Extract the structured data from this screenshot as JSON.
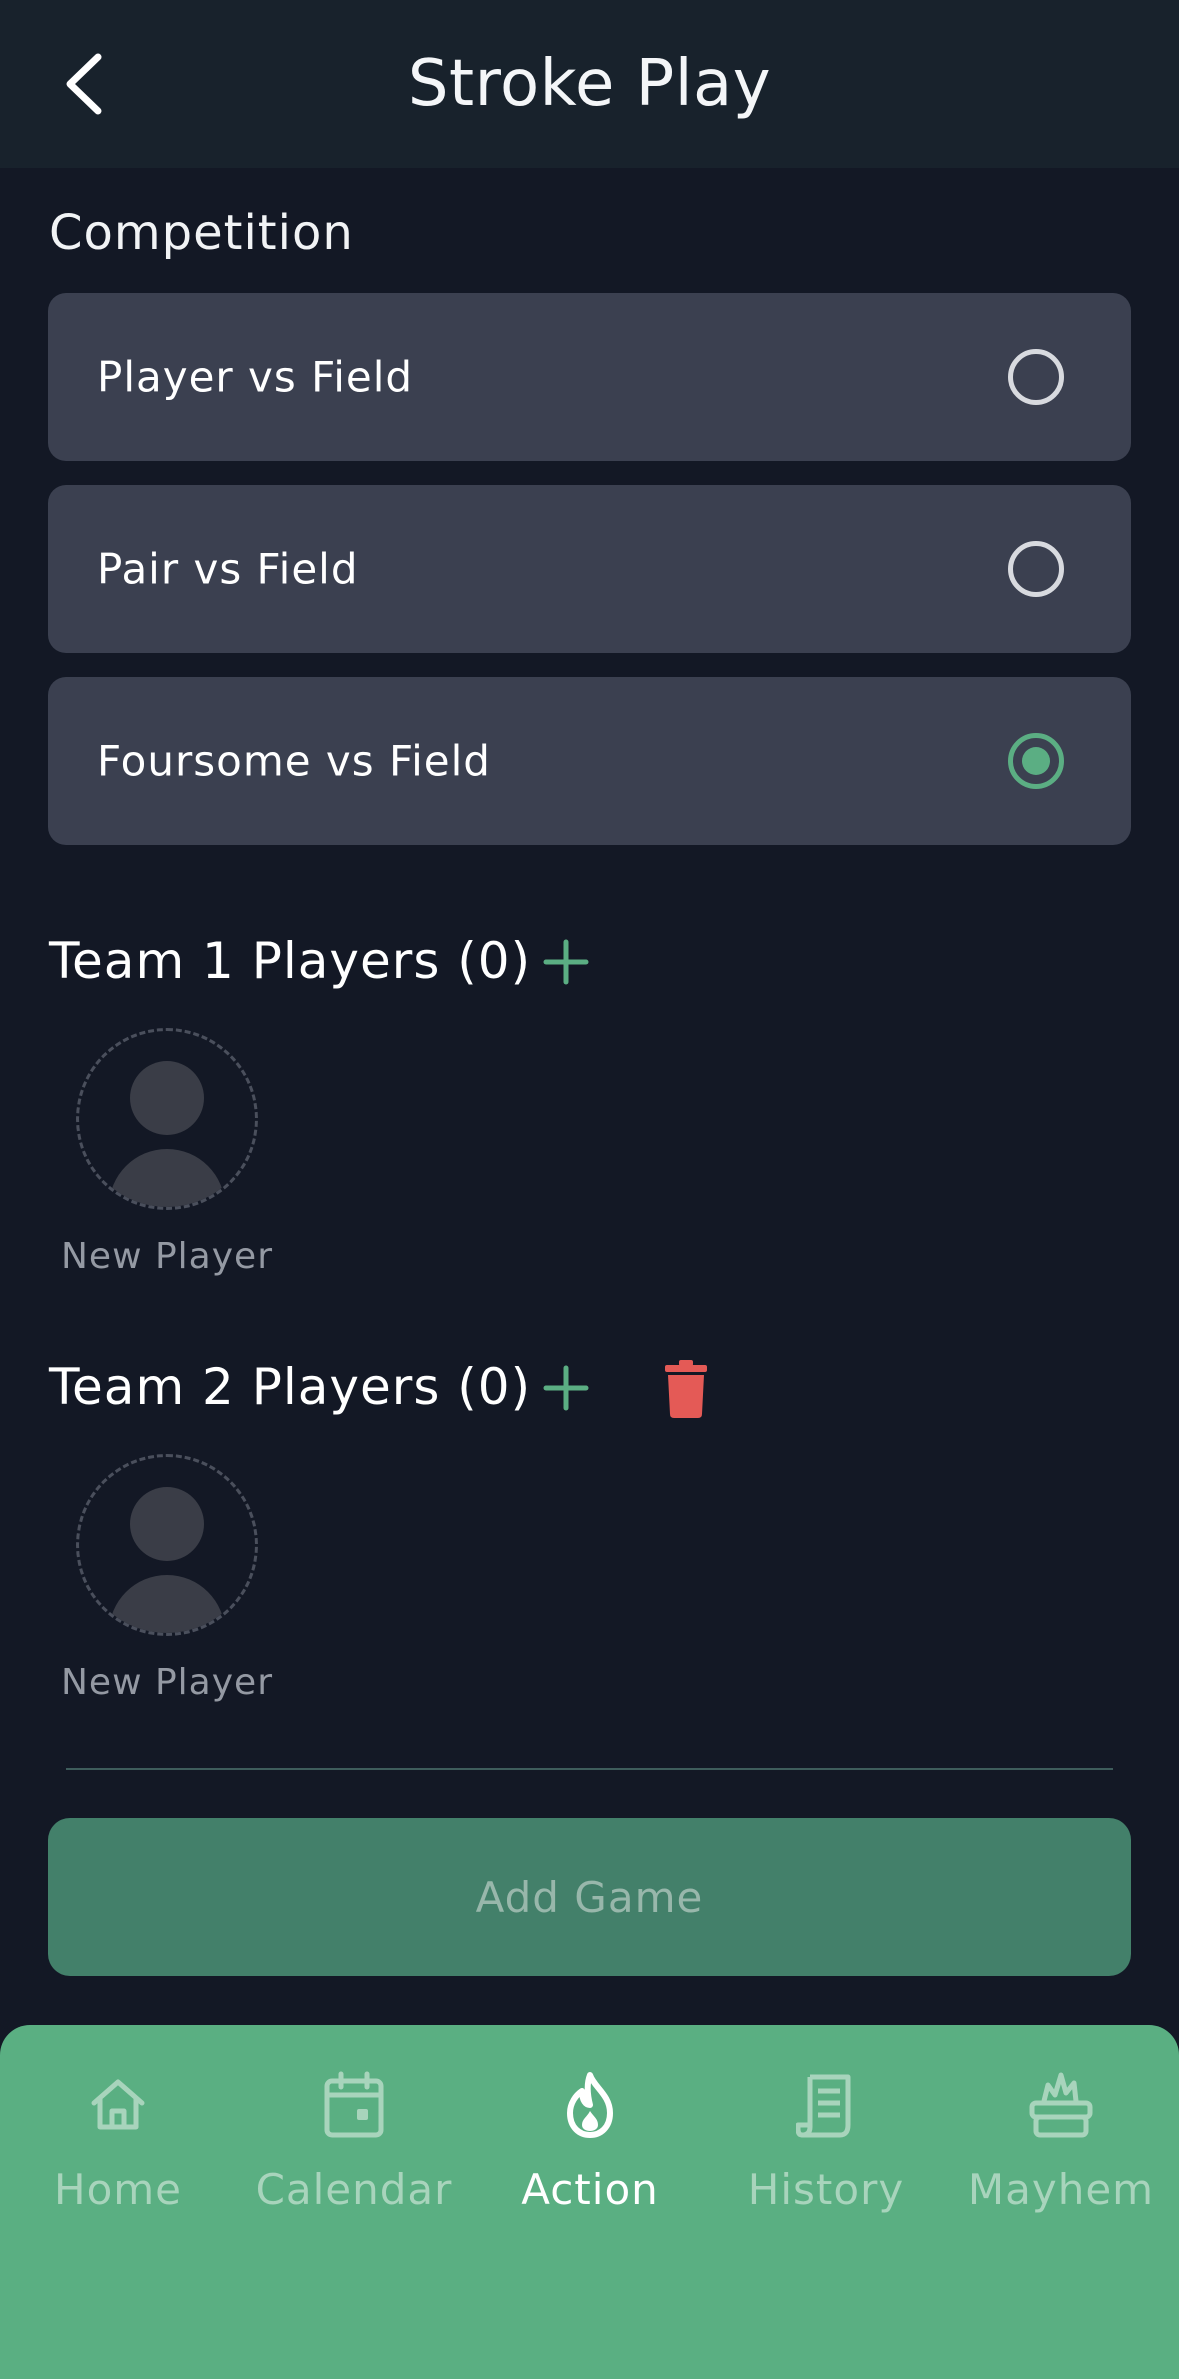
{
  "header": {
    "title": "Stroke Play"
  },
  "competition": {
    "title": "Competition",
    "options": [
      {
        "label": "Player vs Field",
        "selected": false
      },
      {
        "label": "Pair vs Field",
        "selected": false
      },
      {
        "label": "Foursome vs Field",
        "selected": true
      }
    ]
  },
  "teams": [
    {
      "title": "Team 1 Players (0)",
      "player_placeholder": "New Player"
    },
    {
      "title": "Team 2 Players (0)",
      "player_placeholder": "New Player"
    }
  ],
  "add_game_label": "Add Game",
  "nav": {
    "items": [
      {
        "label": "Home",
        "icon": "home-icon",
        "active": false
      },
      {
        "label": "Calendar",
        "icon": "calendar-icon",
        "active": false
      },
      {
        "label": "Action",
        "icon": "flame-icon",
        "active": true
      },
      {
        "label": "History",
        "icon": "receipt-icon",
        "active": false
      },
      {
        "label": "Mayhem",
        "icon": "explosion-icon",
        "active": false
      }
    ]
  },
  "colors": {
    "background": "#131825",
    "header": "#18222c",
    "card": "#3b4050",
    "accent": "#5bae83",
    "danger": "#e45a56",
    "nav_bar": "#5aaf82"
  }
}
